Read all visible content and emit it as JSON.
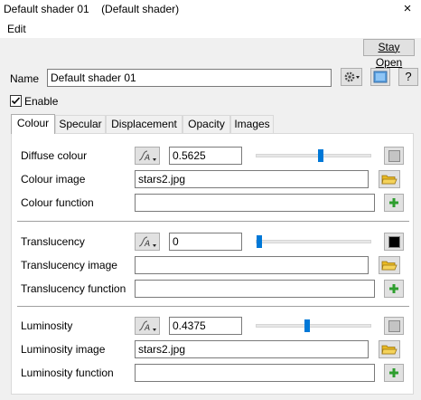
{
  "window": {
    "title": "Default shader 01    (Default shader)",
    "close_glyph": "×"
  },
  "menu": {
    "edit": "Edit"
  },
  "stay_open": "Stay Open",
  "name_label": "Name",
  "name_value": "Default shader 01",
  "enable_label": "Enable",
  "enable_checked": true,
  "tabs": [
    "Colour",
    "Specular",
    "Displacement",
    "Opacity",
    "Images"
  ],
  "active_tab": "Colour",
  "sections": {
    "colour": {
      "label": "Diffuse colour",
      "value": "0.5625",
      "slider": 0.5625,
      "image_label": "Colour image",
      "image_value": "stars2.jpg",
      "function_label": "Colour function",
      "function_value": "",
      "swatch_color": "#c4c4c4"
    },
    "translucency": {
      "label": "Translucency",
      "value": "0",
      "slider": 0,
      "image_label": "Translucency image",
      "image_value": "",
      "function_label": "Translucency function",
      "function_value": "",
      "swatch_color": "#000000"
    },
    "luminosity": {
      "label": "Luminosity",
      "value": "0.4375",
      "slider": 0.4375,
      "image_label": "Luminosity image",
      "image_value": "stars2.jpg",
      "function_label": "Luminosity function",
      "function_value": "",
      "swatch_color": "#c4c4c4"
    }
  },
  "colors": {
    "accent": "#0078d7",
    "folder": "#e8b923",
    "plus": "#2e9e2e"
  },
  "icons": {
    "gear": "gear-icon",
    "image": "image-icon",
    "help": "?",
    "function": "function-icon",
    "folder": "folder-icon",
    "add": "add-icon"
  }
}
